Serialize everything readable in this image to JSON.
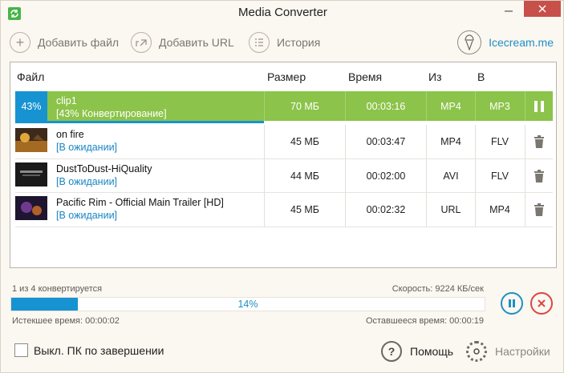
{
  "window": {
    "title": "Media Converter"
  },
  "toolbar": {
    "add_file": "Добавить файл",
    "add_url": "Добавить URL",
    "history": "История",
    "brand": "Icecream.me"
  },
  "table": {
    "headers": [
      "Файл",
      "Размер",
      "Время",
      "Из",
      "В"
    ],
    "rows": [
      {
        "percent": "43%",
        "name": "clip1",
        "status": "[43% Конвертирование]",
        "size": "70 МБ",
        "time": "00:03:16",
        "from": "MP4",
        "to": "MP3",
        "progress": 0.43
      },
      {
        "name": "on fire",
        "status": "[В ожидании]",
        "size": "45 МБ",
        "time": "00:03:47",
        "from": "MP4",
        "to": "FLV"
      },
      {
        "name": "DustToDust-HiQuality",
        "status": "[В ожидании]",
        "size": "44 МБ",
        "time": "00:02:00",
        "from": "AVI",
        "to": "FLV"
      },
      {
        "name": "Pacific Rim - Official Main Trailer [HD]",
        "status": "[В ожидании]",
        "size": "45 МБ",
        "time": "00:02:32",
        "from": "URL",
        "to": "MP4"
      }
    ]
  },
  "progress": {
    "count_text": "1 из 4 конвертируется",
    "speed_text": "Скорость: 9224 КБ/сек",
    "percent_text": "14%",
    "value": 0.14,
    "elapsed_text": "Истекшее время: 00:00:02",
    "remaining_text": "Оставшееся время: 00:00:19"
  },
  "footer": {
    "shutdown_label": "Выкл. ПК по завершении",
    "help_label": "Помощь",
    "settings_label": "Настройки"
  },
  "colors": {
    "accent_green": "#8cc34a",
    "accent_blue": "#1793d1",
    "close_red": "#c7504a"
  }
}
